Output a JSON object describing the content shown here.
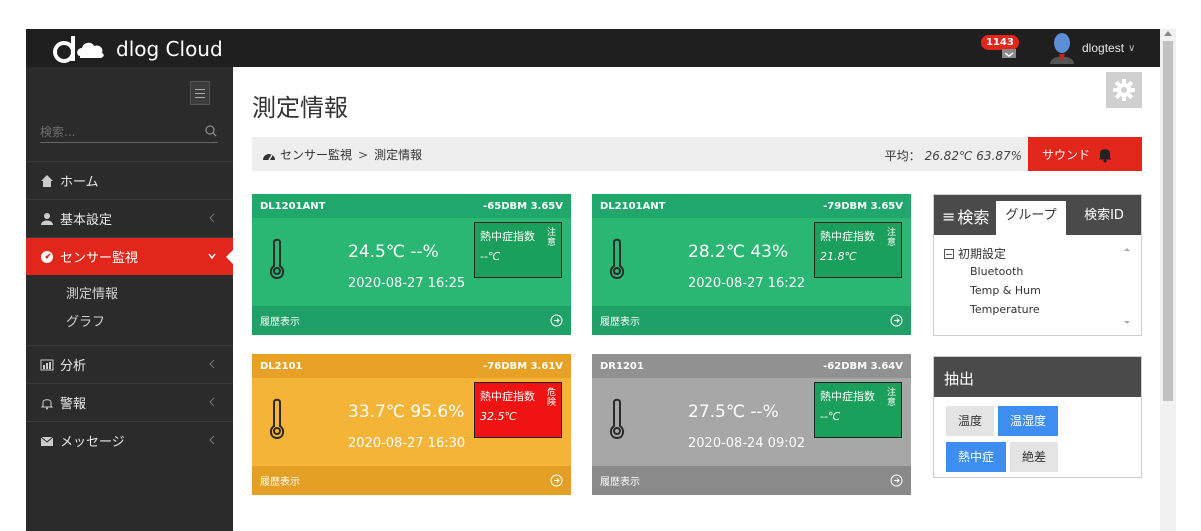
{
  "topbar": {
    "brand": "dlog Cloud",
    "notification_count": "1143",
    "user_name": "dlogtest"
  },
  "sidebar": {
    "search_placeholder": "検索...",
    "items": [
      {
        "label": "ホーム"
      },
      {
        "label": "基本設定"
      },
      {
        "label": "センサー監視"
      },
      {
        "label": "分析"
      },
      {
        "label": "警報"
      },
      {
        "label": "メッセージ"
      }
    ],
    "sub_items": [
      {
        "label": "測定情報"
      },
      {
        "label": "グラフ"
      }
    ]
  },
  "page": {
    "title": "測定情報",
    "breadcrumb": [
      "センサー監視",
      "測定情報"
    ],
    "average_label": "平均：",
    "average_value": "26.82℃ 63.87%",
    "sound_label": "サウンド"
  },
  "cards": [
    {
      "name": "DL1201ANT",
      "signal": "-65DBM 3.65V",
      "reading": "24.5℃ --%",
      "time": "2020-08-27 16:25",
      "heat_title": "熱中症指数",
      "heat_level": "注意",
      "heat_value": "--℃",
      "footer": "履歴表示",
      "color": "green"
    },
    {
      "name": "DL2101ANT",
      "signal": "-79DBM 3.65V",
      "reading": "28.2℃ 43%",
      "time": "2020-08-27 16:22",
      "heat_title": "熱中症指数",
      "heat_level": "注意",
      "heat_value": "21.8℃",
      "footer": "履歴表示",
      "color": "green"
    },
    {
      "name": "DL2101",
      "signal": "-76DBM 3.61V",
      "reading": "33.7℃ 95.6%",
      "time": "2020-08-27 16:30",
      "heat_title": "熱中症指数",
      "heat_level": "危険",
      "heat_value": "32.5℃",
      "footer": "履歴表示",
      "color": "orange"
    },
    {
      "name": "DR1201",
      "signal": "-62DBM 3.64V",
      "reading": "27.5℃ --%",
      "time": "2020-08-24 09:02",
      "heat_title": "熱中症指数",
      "heat_level": "注意",
      "heat_value": "--℃",
      "footer": "履歴表示",
      "color": "gray"
    }
  ],
  "search_panel": {
    "title": "検索",
    "tab_group": "グループ",
    "tab_id": "検索ID",
    "tree_root": "初期設定",
    "tree_children": [
      "Bluetooth",
      "Temp & Hum",
      "Temperature"
    ]
  },
  "extract_panel": {
    "title": "抽出",
    "chips": [
      {
        "label": "温度",
        "selected": false
      },
      {
        "label": "温湿度",
        "selected": true
      },
      {
        "label": "熱中症",
        "selected": true
      },
      {
        "label": "絶差",
        "selected": false
      }
    ]
  },
  "colors": {
    "accent_red": "#e3261b",
    "green": "#2ab673",
    "orange": "#f4b437",
    "gray": "#a7a7a7",
    "chip_blue": "#3d8ef0"
  }
}
